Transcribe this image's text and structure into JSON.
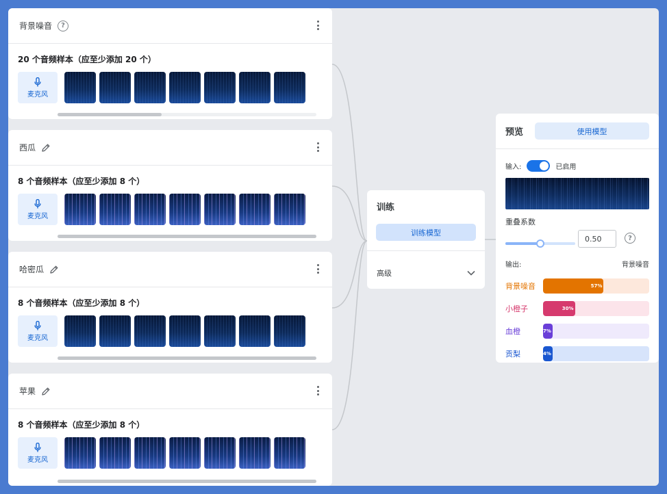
{
  "classes": [
    {
      "name": "背景噪音",
      "sample_count": "20 个音频样本（应至少添加 20 个）",
      "mic_label": "麦克风",
      "icon": "help-icon",
      "spec_style": "noise"
    },
    {
      "name": "西瓜",
      "sample_count": "8 个音频样本（应至少添加 8 个）",
      "mic_label": "麦克风",
      "icon": "edit-icon",
      "spec_style": "stripes"
    },
    {
      "name": "哈密瓜",
      "sample_count": "8 个音频样本（应至少添加 8 个）",
      "mic_label": "麦克风",
      "icon": "edit-icon",
      "spec_style": "noise"
    },
    {
      "name": "苹果",
      "sample_count": "8 个音频样本（应至少添加 8 个）",
      "mic_label": "麦克风",
      "icon": "edit-icon",
      "spec_style": "stripes"
    }
  ],
  "training": {
    "title": "训练",
    "train_button": "训练模型",
    "advanced_label": "高级"
  },
  "preview": {
    "title": "预览",
    "use_model_button": "使用模型",
    "input_label": "输入:",
    "input_enabled": true,
    "input_status": "已启用",
    "overlap_label": "重叠系数",
    "overlap_value": "0.50",
    "overlap_fraction": 0.5,
    "output_label": "输出:",
    "output_top_class": "背景噪音",
    "outputs": [
      {
        "name": "背景噪音",
        "percent_label": "57%",
        "value": 57,
        "color": "#e37400",
        "track": "#fde8dc",
        "text_color": "#e37400"
      },
      {
        "name": "小橙子",
        "percent_label": "30%",
        "value": 30,
        "color": "#d63a6e",
        "track": "#fce4ea",
        "text_color": "#d63a6e"
      },
      {
        "name": "血橙",
        "percent_label": "7%",
        "value": 7,
        "color": "#6a3fd8",
        "track": "#efeafc",
        "text_color": "#6a3fd8"
      },
      {
        "name": "贡梨",
        "percent_label": "4%",
        "value": 4,
        "color": "#1a57d0",
        "track": "#d7e4fb",
        "text_color": "#1a57d0"
      }
    ]
  }
}
